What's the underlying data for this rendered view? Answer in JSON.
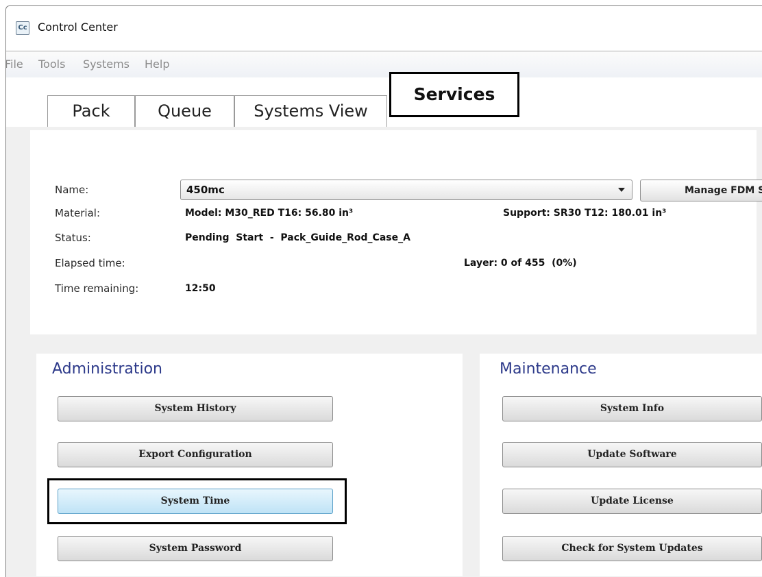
{
  "window": {
    "title": "Control Center",
    "icon": "Cc"
  },
  "menu": [
    "File",
    "Tools",
    "Systems",
    "Help"
  ],
  "tabs": [
    "Pack",
    "Queue",
    "Systems View",
    "Services"
  ],
  "status": {
    "name_label": "Name:",
    "name_value": "450mc",
    "manage_button": "Manage FDM S",
    "material_label": "Material:",
    "material_model": "Model: M30_RED T16: 56.80 in³",
    "material_support": "Support: SR30 T12: 180.01 in³",
    "status_label": "Status:",
    "status_value": "Pending  Start  -  Pack_Guide_Rod_Case_A",
    "elapsed_label": "Elapsed time:",
    "layer_value": "Layer: 0 of 455  (0%)",
    "remaining_label": "Time remaining:",
    "remaining_value": "12:50"
  },
  "administration": {
    "title": "Administration",
    "buttons": [
      "System History",
      "Export Configuration",
      "System Time",
      "System Password"
    ]
  },
  "maintenance": {
    "title": "Maintenance",
    "buttons": [
      "System Info",
      "Update Software",
      "Update License",
      "Check for System Updates"
    ]
  }
}
